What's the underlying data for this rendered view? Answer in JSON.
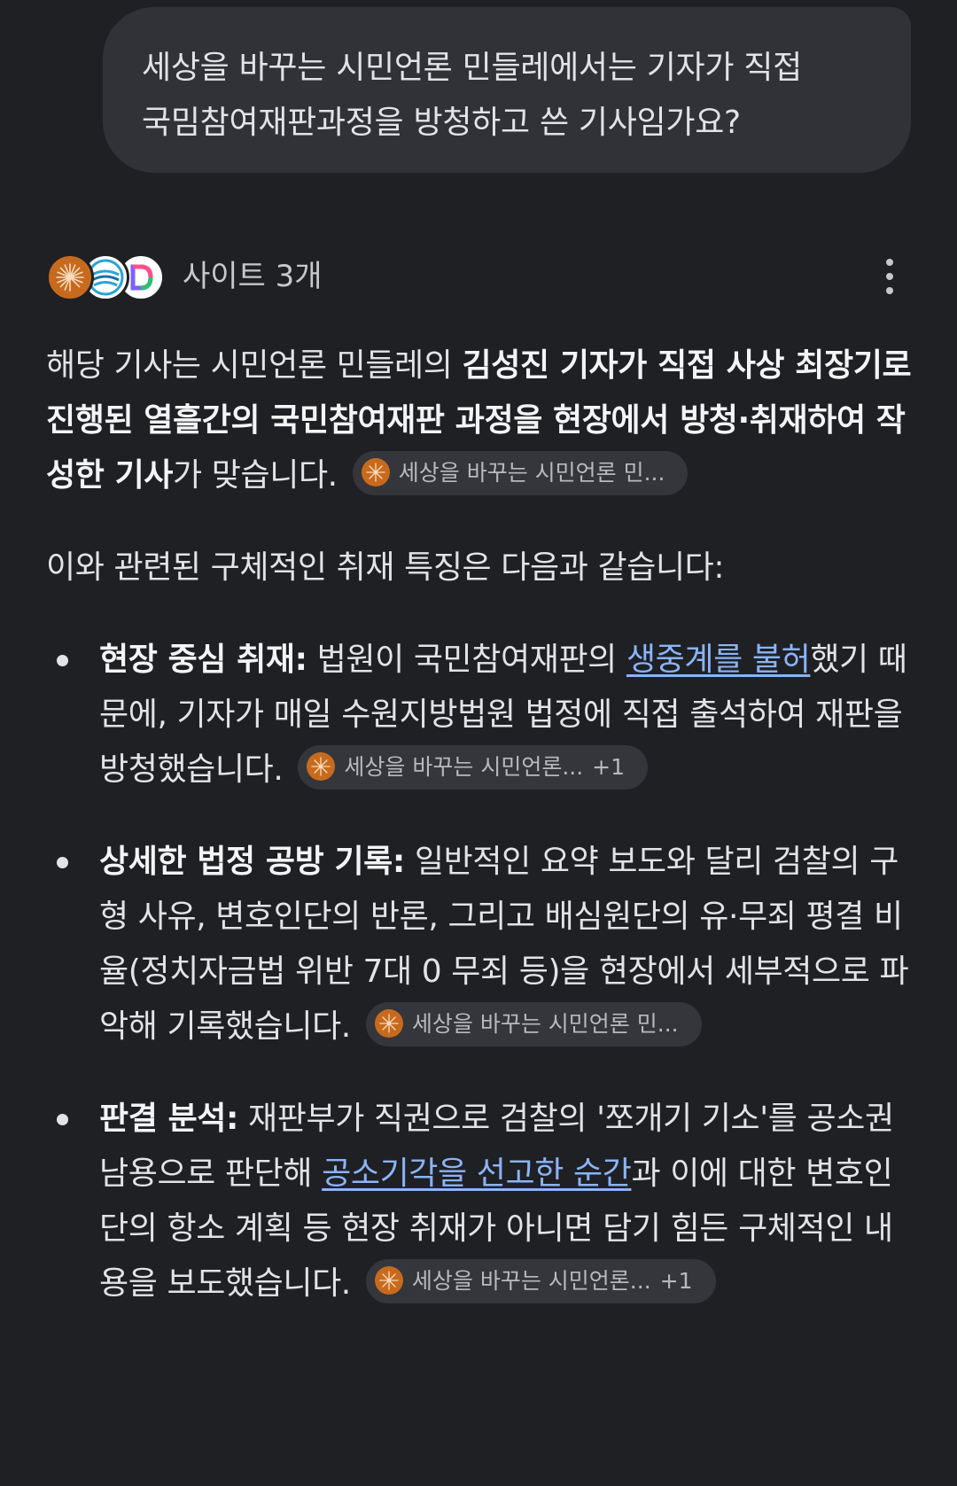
{
  "user_query": {
    "line1": "세상을 바꾸는 시민언론 민들레에서는 기자가 직접",
    "line2": "국밈참여재판과정을 방청하고 쓴 기사임가요?"
  },
  "sources": {
    "label": "사이트 3개",
    "favicons": [
      "minddle-dandelion-favicon",
      "wave-logo-favicon",
      "d-letter-favicon"
    ],
    "more_icon": "vertical-ellipsis-icon"
  },
  "answer": {
    "intro": {
      "prefix": "해당 기사는 시민언론 민들레의 ",
      "bold": "김성진 기자가 직접 사상 최장기로 진행된 열흘간의 국민참여재판 과정을 현장에서 방청·취재하여 작성한 기사",
      "suffix": "가 맞습니다.",
      "chip": {
        "label": "세상을 바꾸는 시민언론 민...",
        "extra": ""
      }
    },
    "intro2": "이와 관련된 구체적인 취재 특징은 다음과 같습니다:",
    "bullets": [
      {
        "title": "현장 중심 취재:",
        "before_link": " 법원이 국민참여재판의 ",
        "link": "생중계를 불허",
        "after_link": "했기 때문에, 기자가 매일 수원지방법원 법정에 직접 출석하여 재판을 방청했습니다.",
        "chip_label": "세상을 바꾸는 시민언론...",
        "chip_extra": "+1"
      },
      {
        "title": "상세한 법정 공방 기록:",
        "before_link": " 일반적인 요약 보도와 달리 검찰의 구형 사유, 변호인단의 반론, 그리고 배심원단의 유·무죄 평결 비율(정치자금법 위반 7대 0 무죄 등)을 현장에서 세부적으로 파악해 기록했습니다.",
        "link": "",
        "after_link": "",
        "chip_label": "세상을 바꾸는 시민언론 민...",
        "chip_extra": ""
      },
      {
        "title": "판결 분석:",
        "before_link": " 재판부가 직권으로 검찰의 '쪼개기 기소'를 공소권 남용으로 판단해 ",
        "link": "공소기각을 선고한 순간",
        "after_link": "과 이에 대한 변호인단의 항소 계획 등 현장 취재가 아니면 담기 힘든 구체적인 내용을 보도했습니다.",
        "chip_label": "세상을 바꾸는 시민언론...",
        "chip_extra": "+1"
      }
    ]
  },
  "colors": {
    "background": "#1f2023",
    "bubble": "#303237",
    "chip": "#34363b",
    "link": "#8ab4f8",
    "favicon_orange": "#c86a1e"
  }
}
